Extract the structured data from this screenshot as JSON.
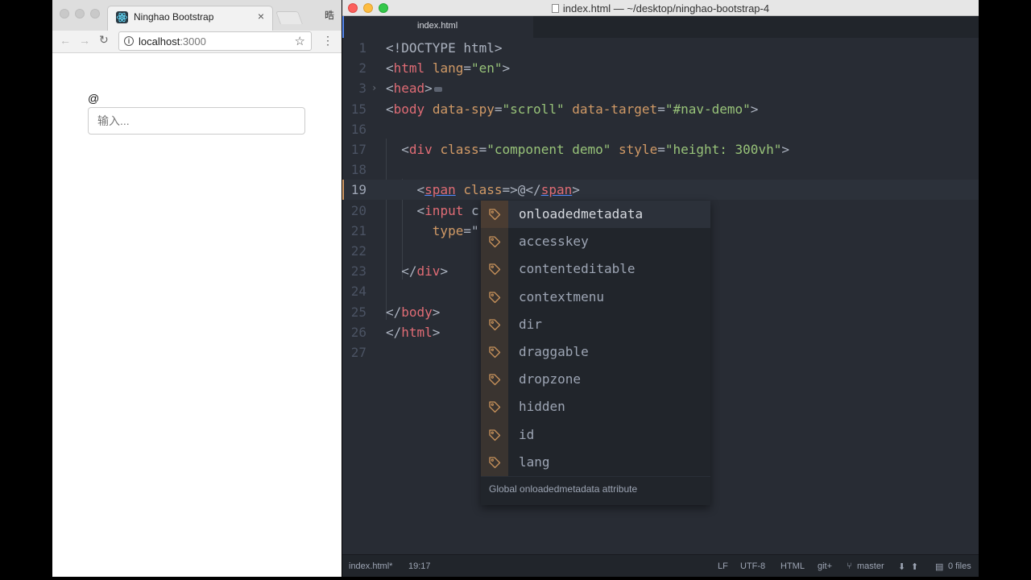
{
  "browser": {
    "tab_title": "Ninghao Bootstrap",
    "tab_close": "×",
    "profile_glyph": "晧",
    "url_host": "localhost",
    "url_port": ":3000",
    "back_glyph": "←",
    "forward_glyph": "→",
    "reload_glyph": "↻",
    "star_glyph": "☆",
    "menu_glyph": "⋮",
    "info_glyph": "i",
    "page": {
      "at_label": "@",
      "input_placeholder": "输入..."
    }
  },
  "editor": {
    "window_title": "index.html — ~/desktop/ninghao-bootstrap-4",
    "tab_label": "index.html",
    "lines": [
      {
        "num": "1",
        "segments": [
          [
            "t-doc",
            "<!DOCTYPE html>"
          ]
        ]
      },
      {
        "num": "2",
        "segments": [
          [
            "t-punc",
            "<"
          ],
          [
            "t-tag",
            "html"
          ],
          [
            "t-punc",
            " "
          ],
          [
            "t-attr",
            "lang"
          ],
          [
            "t-punc",
            "="
          ],
          [
            "t-str",
            "\"en\""
          ],
          [
            "t-punc",
            ">"
          ]
        ]
      },
      {
        "num": "3",
        "fold": "›",
        "ellipsis": true,
        "segments": [
          [
            "t-punc",
            "<"
          ],
          [
            "t-tag",
            "head"
          ],
          [
            "t-punc",
            ">"
          ]
        ]
      },
      {
        "num": "15",
        "segments": [
          [
            "t-punc",
            "<"
          ],
          [
            "t-tag",
            "body"
          ],
          [
            "t-punc",
            " "
          ],
          [
            "t-attr",
            "data-spy"
          ],
          [
            "t-punc",
            "="
          ],
          [
            "t-str",
            "\"scroll\""
          ],
          [
            "t-punc",
            " "
          ],
          [
            "t-attr",
            "data-target"
          ],
          [
            "t-punc",
            "="
          ],
          [
            "t-str",
            "\"#nav-demo\""
          ],
          [
            "t-punc",
            ">"
          ]
        ]
      },
      {
        "num": "16",
        "segments": []
      },
      {
        "num": "17",
        "segments": [
          [
            "t-punc",
            "  <"
          ],
          [
            "t-tag",
            "div"
          ],
          [
            "t-punc",
            " "
          ],
          [
            "t-attr",
            "class"
          ],
          [
            "t-punc",
            "="
          ],
          [
            "t-str",
            "\"component demo\""
          ],
          [
            "t-punc",
            " "
          ],
          [
            "t-attr",
            "style"
          ],
          [
            "t-punc",
            "="
          ],
          [
            "t-str",
            "\"height: 300vh\""
          ],
          [
            "t-punc",
            ">"
          ]
        ]
      },
      {
        "num": "18",
        "segments": []
      },
      {
        "num": "19",
        "current": true,
        "segments": [
          [
            "t-punc",
            "    <"
          ],
          [
            "t-tag underline",
            "span"
          ],
          [
            "t-punc",
            " "
          ],
          [
            "t-attr",
            "class"
          ],
          [
            "t-punc",
            "=>@</"
          ],
          [
            "t-tag underline",
            "span"
          ],
          [
            "t-punc",
            ">"
          ]
        ]
      },
      {
        "num": "20",
        "segments": [
          [
            "t-punc",
            "    <"
          ],
          [
            "t-tag",
            "input"
          ],
          [
            "t-punc",
            " c"
          ]
        ]
      },
      {
        "num": "21",
        "segments": [
          [
            "t-punc",
            "      "
          ],
          [
            "t-attr",
            "type"
          ],
          [
            "t-punc",
            "=\""
          ]
        ]
      },
      {
        "num": "22",
        "segments": []
      },
      {
        "num": "23",
        "segments": [
          [
            "t-punc",
            "  </"
          ],
          [
            "t-tag",
            "div"
          ],
          [
            "t-punc",
            ">"
          ]
        ]
      },
      {
        "num": "24",
        "segments": []
      },
      {
        "num": "25",
        "segments": [
          [
            "t-punc",
            "</"
          ],
          [
            "t-tag",
            "body"
          ],
          [
            "t-punc",
            ">"
          ]
        ]
      },
      {
        "num": "26",
        "segments": [
          [
            "t-punc",
            "</"
          ],
          [
            "t-tag",
            "html"
          ],
          [
            "t-punc",
            ">"
          ]
        ]
      },
      {
        "num": "27",
        "segments": []
      }
    ],
    "autocomplete": {
      "items": [
        "onloadedmetadata",
        "accesskey",
        "contenteditable",
        "contextmenu",
        "dir",
        "draggable",
        "dropzone",
        "hidden",
        "id",
        "lang"
      ],
      "selected_index": 0,
      "icon": "tag-icon",
      "description": "Global onloadedmetadata attribute"
    },
    "status": {
      "file": "index.html*",
      "position": "19:17",
      "line_ending": "LF",
      "encoding": "UTF-8",
      "grammar": "HTML",
      "git": "git+",
      "branch": "master",
      "files": "0 files"
    },
    "colors": {
      "background": "#282c34",
      "tag": "#e06c75",
      "attribute": "#d19a66",
      "string": "#98c379",
      "accent": "#568af2"
    }
  }
}
